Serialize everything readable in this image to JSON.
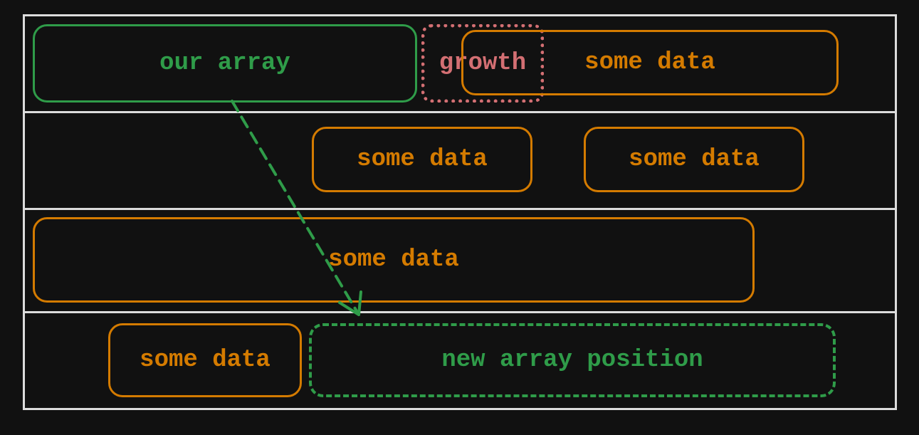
{
  "diagram": {
    "row1": {
      "our_array": "our array",
      "growth": "growth",
      "some_data": "some data"
    },
    "row2": {
      "some_data_a": "some data",
      "some_data_b": "some data"
    },
    "row3": {
      "some_data": "some data"
    },
    "row4": {
      "some_data": "some data",
      "new_array_position": "new array position"
    },
    "colors": {
      "green": "#2f9c49",
      "orange": "#d47b00",
      "red": "#d36f73",
      "grid": "#dcdcdc",
      "bg": "#111111"
    }
  }
}
